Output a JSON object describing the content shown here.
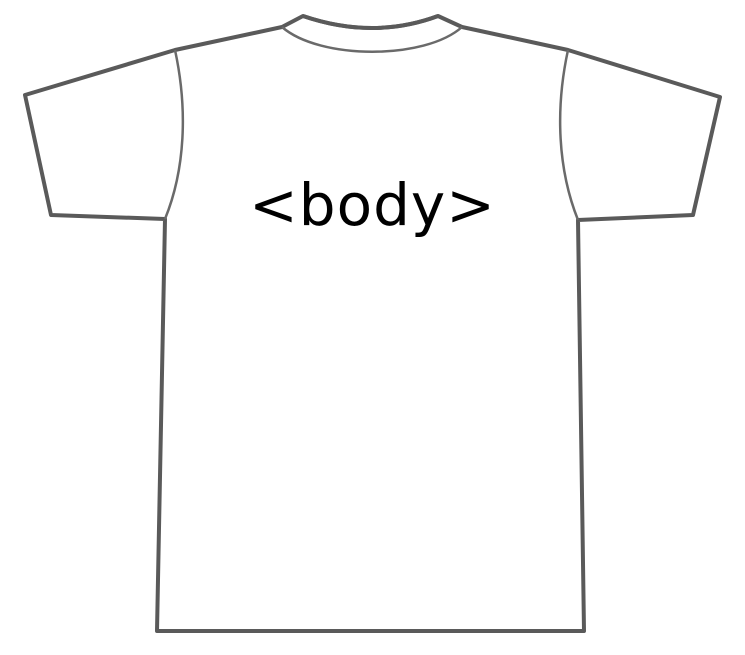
{
  "shirt": {
    "print_text": "<body>",
    "outline_color": "#5a5a5a",
    "fill_color": "#ffffff",
    "text_color": "#000000"
  }
}
